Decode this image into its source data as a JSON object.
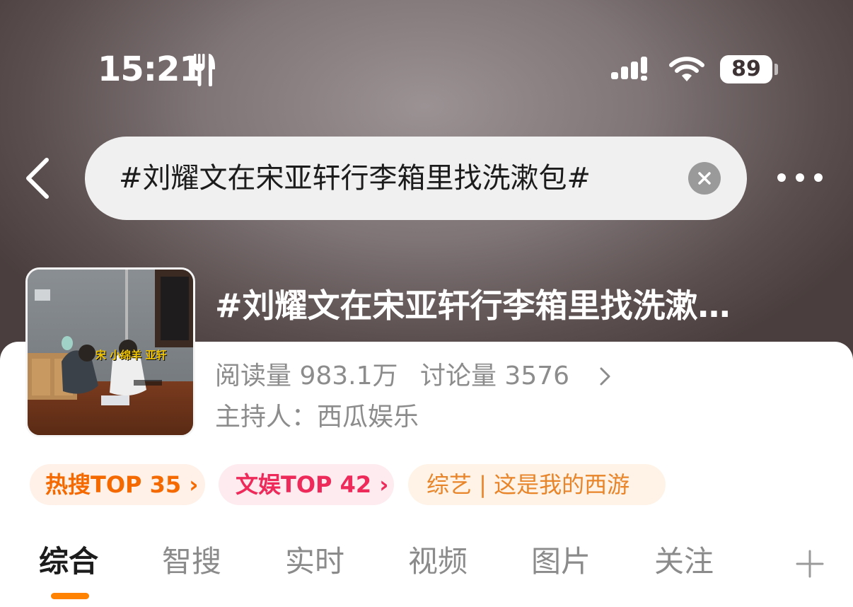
{
  "status_bar": {
    "time": "15:21",
    "battery": "89",
    "icons": [
      "fork-knife-icon",
      "signal-icon",
      "wifi-icon",
      "battery-icon"
    ]
  },
  "search": {
    "query": "#刘耀文在宋亚轩行李箱里找洗漱包#",
    "icons": [
      "back-icon",
      "clear-icon",
      "more-icon"
    ]
  },
  "topic": {
    "title": "#刘耀文在宋亚轩行李箱里找洗漱…",
    "thumbnail_caption": "宋 小绵羊 亚轩",
    "reads": "阅读量 983.1万",
    "discussions": "讨论量 3576",
    "host": "主持人：西瓜娱乐"
  },
  "tags": {
    "hot": "热搜TOP 35 ›",
    "ent": "文娱TOP 42 ›",
    "variety": "综艺 | 这是我的西游"
  },
  "tabs": [
    "综合",
    "智搜",
    "实时",
    "视频",
    "图片",
    "关注"
  ],
  "colors": {
    "accent": "#ff8200",
    "hot_tag": "#f56a00",
    "ent_tag": "#ee2a5b",
    "variety_tag": "#e8852a"
  }
}
